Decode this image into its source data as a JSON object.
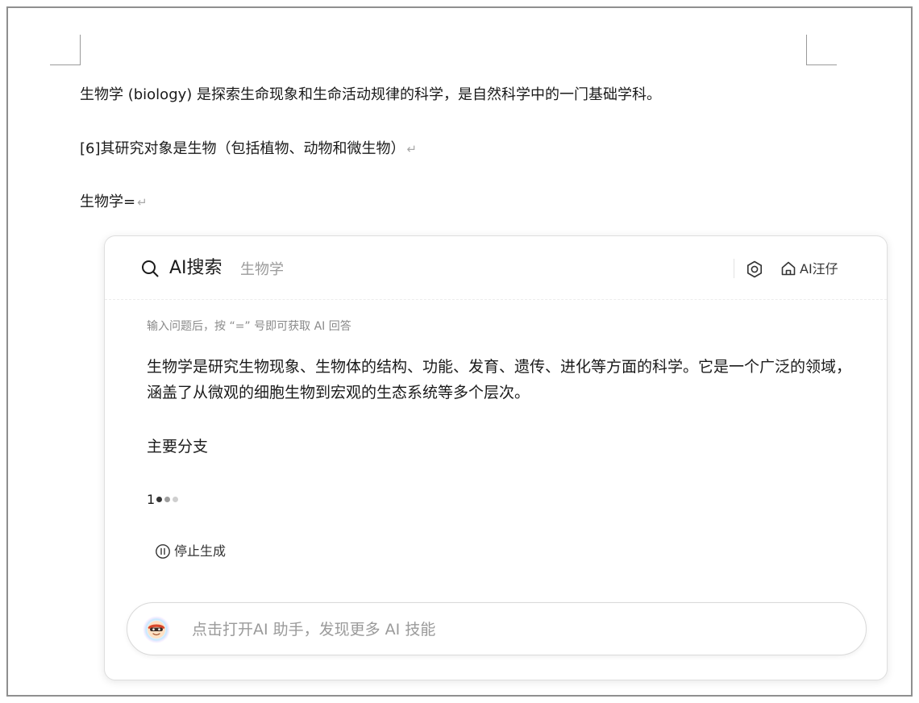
{
  "document": {
    "lines": [
      "生物学 (biology) 是探索生命现象和生命活动规律的科学，是自然科学中的一门基础学科。",
      "[6]其研究对象是生物（包括植物、动物和微生物）",
      "生物学="
    ],
    "paragraph_mark": "↵"
  },
  "ai_panel": {
    "header": {
      "title": "AI搜索",
      "query": "生物学",
      "brand_label": "AI汪仔",
      "icons": [
        "search-icon",
        "settings-icon",
        "home-icon"
      ]
    },
    "hint": "输入问题后，按 “=” 号即可获取 AI 回答",
    "answer": {
      "text": "生物学是研究生物现象、生物体的结构、功能、发育、遗传、进化等方面的科学。它是一个广泛的领域，涵盖了从微观的细胞生物到宏观的生态系统等多个层次。",
      "heading": "主要分支",
      "list_number": "1"
    },
    "loading": {
      "dot_colors": [
        "#333333",
        "#9e9e9e",
        "#cfcfcf"
      ]
    },
    "stop_button": {
      "label": "停止生成"
    },
    "assistant_bar": {
      "placeholder": "点击打开AI 助手，发现更多 AI 技能"
    }
  }
}
